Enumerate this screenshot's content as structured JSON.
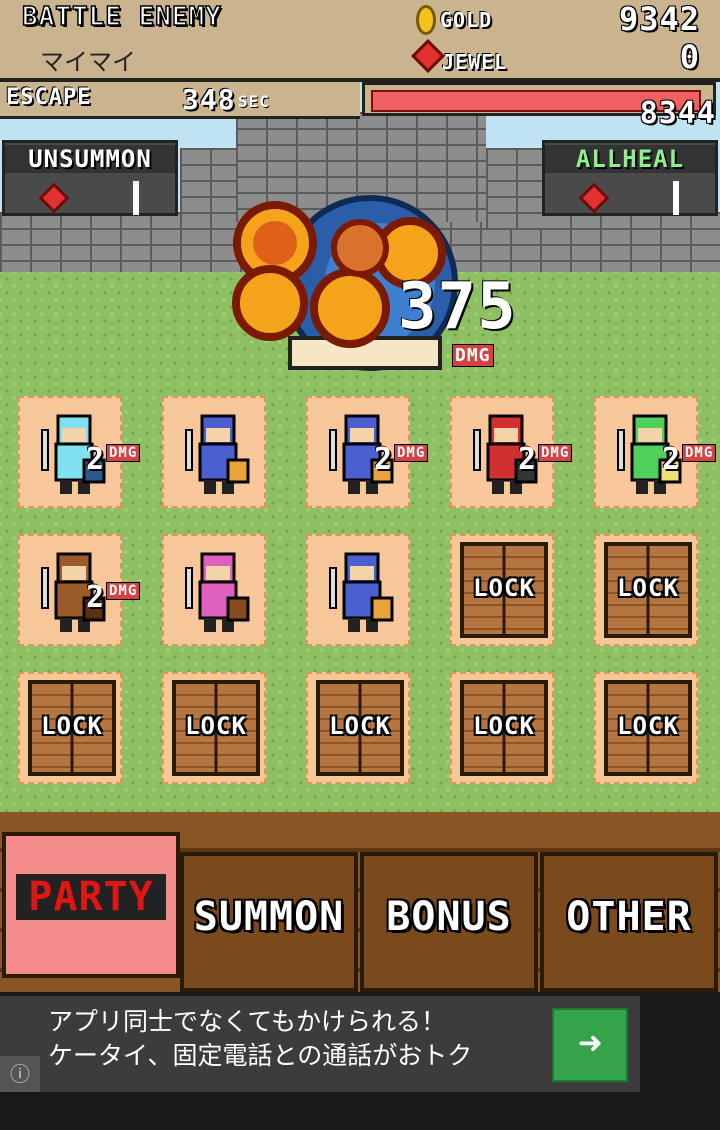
{
  "header": {
    "enemy_label": "BATTLE ENEMY",
    "enemy_name": "マイマイ",
    "gold_label": "GOLD",
    "gold_value": "9342",
    "jewel_label": "JEWEL",
    "jewel_value": "0"
  },
  "escape": {
    "label": "ESCAPE",
    "seconds": "348",
    "unit": "SEC"
  },
  "enemy_hp": {
    "value": "8344",
    "fill_fraction": 0.97
  },
  "buttons": {
    "unsummon": "UNSUMMON",
    "allheal": "ALLHEAL"
  },
  "battle": {
    "damage": "375",
    "damage_unit": "DMG"
  },
  "party": [
    {
      "unit": "swordsman-cyan",
      "dmg": "2",
      "dmg_label": "DMG"
    },
    {
      "unit": "viking-shield",
      "dmg": "",
      "dmg_label": ""
    },
    {
      "unit": "viking-shield",
      "dmg": "2",
      "dmg_label": "DMG"
    },
    {
      "unit": "masked-warrior",
      "dmg": "2",
      "dmg_label": "DMG"
    },
    {
      "unit": "green-cleric",
      "dmg": "2",
      "dmg_label": "DMG"
    },
    {
      "unit": "spearman",
      "dmg": "2",
      "dmg_label": "DMG"
    },
    {
      "unit": "villager",
      "dmg": "",
      "dmg_label": ""
    },
    {
      "unit": "viking-shield",
      "dmg": "",
      "dmg_label": ""
    },
    {
      "unit": "lock",
      "label": "LOCK"
    },
    {
      "unit": "lock",
      "label": "LOCK"
    },
    {
      "unit": "lock",
      "label": "LOCK"
    },
    {
      "unit": "lock",
      "label": "LOCK"
    },
    {
      "unit": "lock",
      "label": "LOCK"
    },
    {
      "unit": "lock",
      "label": "LOCK"
    },
    {
      "unit": "lock",
      "label": "LOCK"
    }
  ],
  "tabs": [
    {
      "label": "PARTY",
      "active": true
    },
    {
      "label": "SUMMON",
      "active": false
    },
    {
      "label": "BONUS",
      "active": false
    },
    {
      "label": "OTHER",
      "active": false
    }
  ],
  "ad": {
    "line1": "アプリ同士でなくてもかけられる！",
    "line2": "ケータイ、固定電話との通話がおトク",
    "go_icon": "➜",
    "info_icon": "ⓘ"
  },
  "colors": {
    "hp_fill": "#f06060",
    "active_tab": "#f48c8c",
    "ad_go": "#34a34a"
  }
}
